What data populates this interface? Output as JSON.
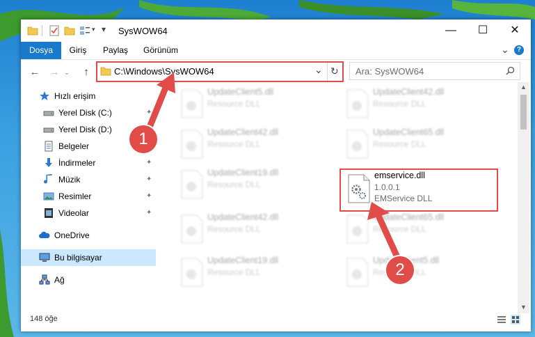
{
  "window": {
    "title": "SysWOW64",
    "minimize_glyph": "—",
    "maximize_glyph": "☐",
    "close_glyph": "✕",
    "accent_color": "#1979ca"
  },
  "ribbon": {
    "tabs": [
      {
        "label": "Dosya",
        "active": true
      },
      {
        "label": "Giriş"
      },
      {
        "label": "Paylaş"
      },
      {
        "label": "Görünüm"
      }
    ],
    "help_glyph": "?",
    "expand_glyph": "⌄"
  },
  "address": {
    "path": "C:\\Windows\\SysWOW64",
    "back_glyph": "←",
    "forward_glyph": "→",
    "up_glyph": "↑",
    "dropdown_glyph": "⌄",
    "refresh_glyph": "↻"
  },
  "search": {
    "placeholder": "Ara: SysWOW64",
    "icon": "search-icon"
  },
  "nav": {
    "items": [
      {
        "label": "Hızlı erişim",
        "icon": "star-icon"
      },
      {
        "label": "Yerel Disk (C:)",
        "icon": "drive-icon",
        "pinned": true
      },
      {
        "label": "Yerel Disk (D:)",
        "icon": "drive-icon",
        "pinned": true
      },
      {
        "label": "Belgeler",
        "icon": "document-icon",
        "pinned": true
      },
      {
        "label": "İndirmeler",
        "icon": "download-icon",
        "pinned": true
      },
      {
        "label": "Müzik",
        "icon": "music-icon",
        "pinned": true
      },
      {
        "label": "Resimler",
        "icon": "pictures-icon",
        "pinned": true
      },
      {
        "label": "Videolar",
        "icon": "video-icon",
        "pinned": true
      },
      {
        "label": "OneDrive",
        "icon": "cloud-icon"
      },
      {
        "label": "Bu bilgisayar",
        "icon": "computer-icon",
        "selected": true
      },
      {
        "label": "Ağ",
        "icon": "network-icon"
      }
    ],
    "pin_glyph": "📌"
  },
  "files": [
    {
      "name": "UpdateClient5.dll",
      "type": "Resource DLL",
      "blurred": true
    },
    {
      "name": "UpdateClient42.dll",
      "type": "Resource DLL",
      "blurred": true
    },
    {
      "name": "UpdateClient42.dll",
      "type": "Resource DLL",
      "blurred": true
    },
    {
      "name": "UpdateClient65.dll",
      "type": "Resource DLL",
      "blurred": true
    },
    {
      "name": "UpdateClient19.dll",
      "type": "Resource DLL",
      "blurred": true
    },
    {
      "name": "emservice.dll",
      "version": "1.0.0.1",
      "type": "EMService DLL",
      "blurred": false,
      "highlighted": true
    },
    {
      "name": "UpdateClient42.dll",
      "type": "Resource DLL",
      "blurred": true
    },
    {
      "name": "UpdateClient65.dll",
      "type": "Resource DLL",
      "blurred": true
    },
    {
      "name": "UpdateClient19.dll",
      "type": "Resource DLL",
      "blurred": true
    },
    {
      "name": "UpdateClient5.dll",
      "type": "Resource DLL",
      "blurred": true
    }
  ],
  "status": {
    "item_count": "148 öğe"
  },
  "annotations": {
    "step1": "1",
    "step2": "2",
    "color": "#e14b48"
  }
}
